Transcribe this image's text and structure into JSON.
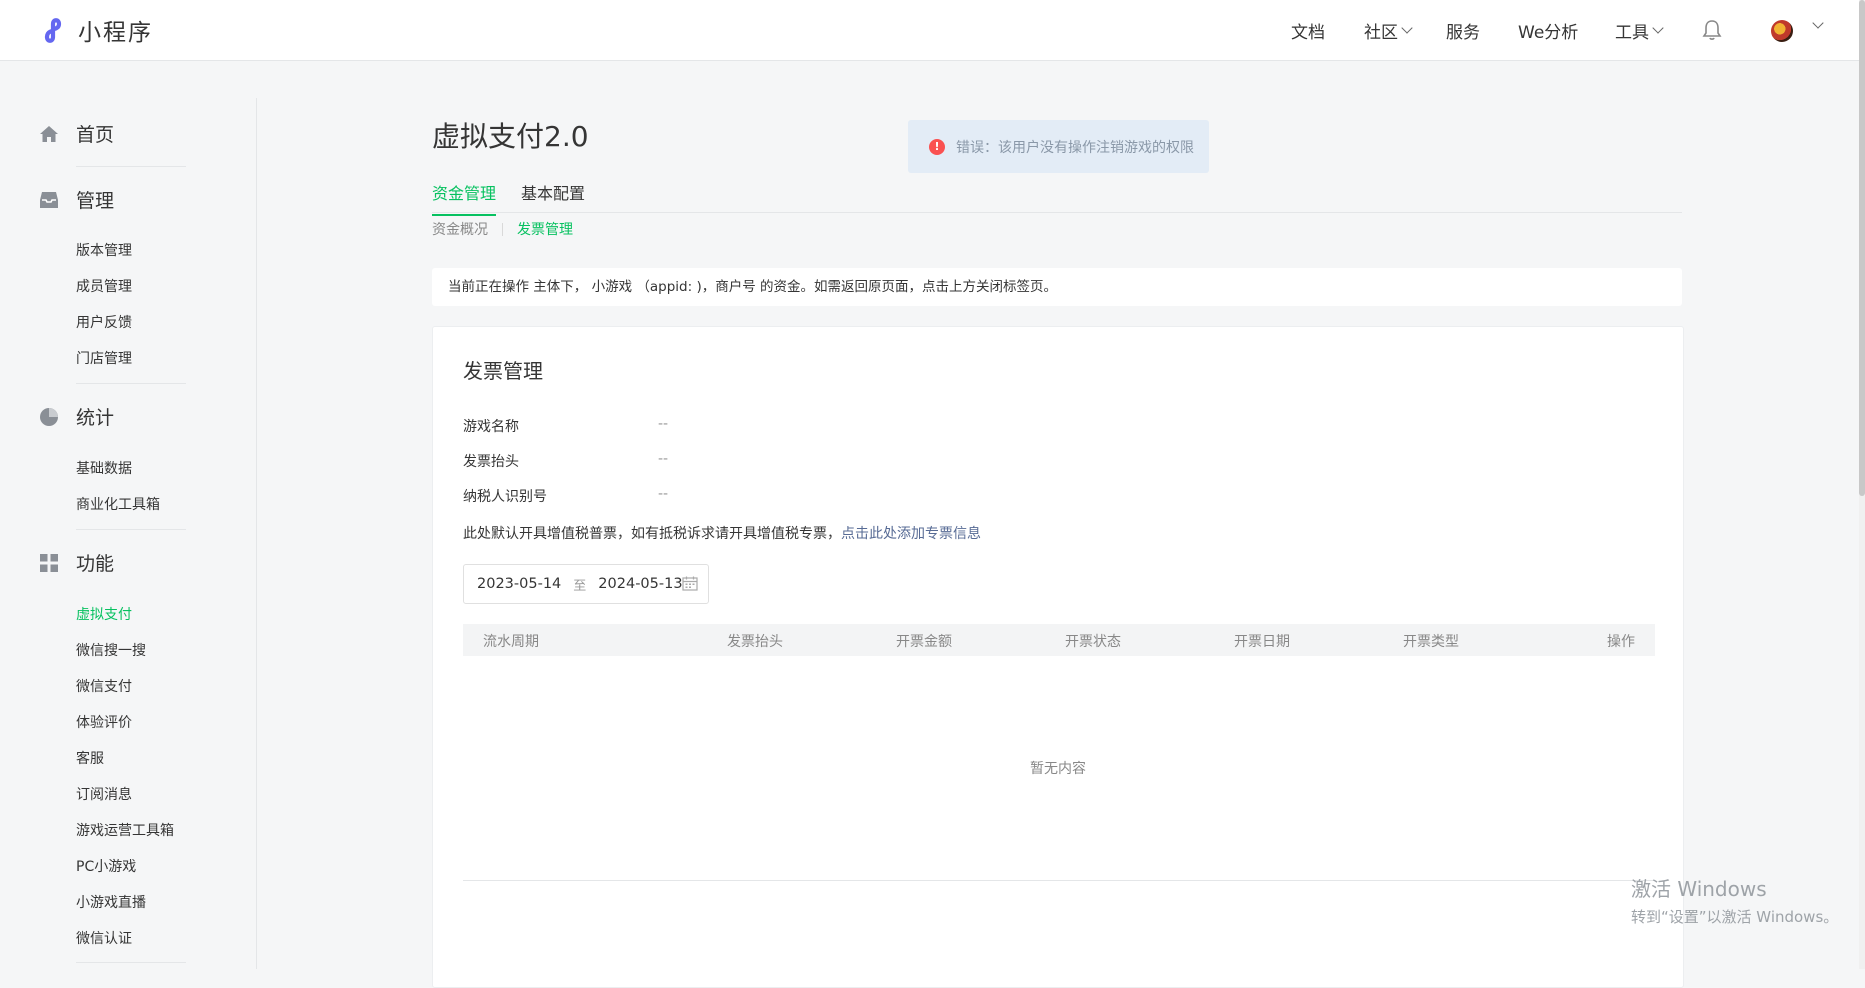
{
  "app": {
    "name": "小程序"
  },
  "topnav": {
    "docs": "文档",
    "community": "社区",
    "services": "服务",
    "we_analytics": "We分析",
    "tools": "工具"
  },
  "sidebar": {
    "home": "首页",
    "manage": {
      "title": "管理",
      "items": [
        "版本管理",
        "成员管理",
        "用户反馈",
        "门店管理"
      ]
    },
    "stats": {
      "title": "统计",
      "items": [
        "基础数据",
        "商业化工具箱"
      ]
    },
    "features": {
      "title": "功能",
      "items": [
        "虚拟支付",
        "微信搜一搜",
        "微信支付",
        "体验评价",
        "客服",
        "订阅消息",
        "游戏运营工具箱",
        "PC小游戏",
        "小游戏直播",
        "微信认证"
      ],
      "active": "虚拟支付"
    }
  },
  "page": {
    "title": "虚拟支付2.0",
    "tabs": [
      "资金管理",
      "基本配置"
    ],
    "active_tab": "资金管理",
    "subtabs": [
      "资金概况",
      "发票管理"
    ],
    "active_subtab": "发票管理",
    "notice": "当前正在操作 主体下， 小游戏 （appid: )，商户号 的资金。如需返回原页面，点击上方关闭标签页。"
  },
  "invoice": {
    "title": "发票管理",
    "fields": [
      {
        "label": "游戏名称",
        "value": "--"
      },
      {
        "label": "发票抬头",
        "value": "--"
      },
      {
        "label": "纳税人识别号",
        "value": "--"
      }
    ],
    "hint": "此处默认开具增值税普票，如有抵税诉求请开具增值税专票，",
    "hint_link": "点击此处添加专票信息",
    "date_start": "2023-05-14",
    "date_sep": "至",
    "date_end": "2024-05-13",
    "columns": [
      "流水周期",
      "发票抬头",
      "开票金额",
      "开票状态",
      "开票日期",
      "开票类型",
      "操作"
    ],
    "empty_text": "暂无内容"
  },
  "toast": {
    "text": "错误：该用户没有操作注销游戏的权限"
  },
  "watermark": {
    "line1": "激活 Windows",
    "line2": "转到“设置”以激活 Windows。"
  },
  "colors": {
    "accent": "#07c160",
    "link": "#576b95",
    "error": "#fa5151"
  }
}
